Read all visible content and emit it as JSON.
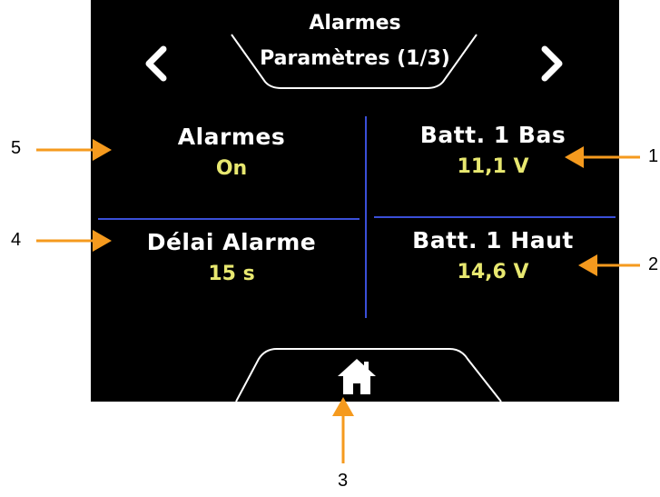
{
  "header": {
    "title_line1": "Alarmes",
    "title_line2": "Paramètres (1/3)"
  },
  "nav": {
    "prev_icon": "chevron-left-icon",
    "next_icon": "chevron-right-icon",
    "home_icon": "home-icon"
  },
  "settings": {
    "alarmes": {
      "label": "Alarmes",
      "value": "On"
    },
    "delai": {
      "label": "Délai Alarme",
      "value": "15 s"
    },
    "batt_bas": {
      "label": "Batt. 1 Bas",
      "value": "11,1 V"
    },
    "batt_haut": {
      "label": "Batt. 1 Haut",
      "value": "14,6 V"
    }
  },
  "callouts": {
    "c1": "1",
    "c2": "2",
    "c3": "3",
    "c4": "4",
    "c5": "5"
  },
  "colors": {
    "screen_bg": "#000000",
    "label": "#ffffff",
    "value": "#e8e870",
    "divider": "#3a4fd8",
    "callout_arrow": "#f59a1e"
  }
}
